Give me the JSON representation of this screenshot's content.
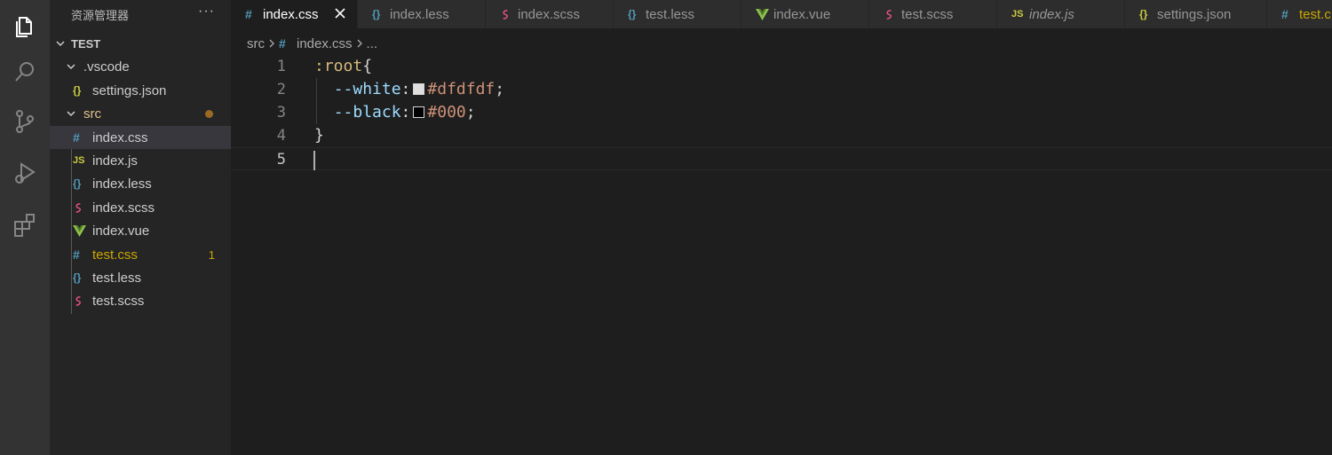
{
  "sidebar": {
    "title": "资源管理器",
    "more": "···",
    "tree": [
      {
        "label": "TEST",
        "kind": "root"
      },
      {
        "label": ".vscode",
        "kind": "folder"
      },
      {
        "label": "settings.json",
        "kind": "file",
        "icon": "{}"
      },
      {
        "label": "src",
        "kind": "folder"
      },
      {
        "label": "index.css",
        "kind": "file",
        "icon": "#"
      },
      {
        "label": "index.js",
        "kind": "file",
        "icon": "JS"
      },
      {
        "label": "index.less",
        "kind": "file",
        "icon": "{}"
      },
      {
        "label": "index.scss",
        "kind": "file",
        "icon": "sass"
      },
      {
        "label": "index.vue",
        "kind": "file",
        "icon": "vue"
      },
      {
        "label": "test.css",
        "kind": "file",
        "icon": "#",
        "badge": "1"
      },
      {
        "label": "test.less",
        "kind": "file",
        "icon": "{}"
      },
      {
        "label": "test.scss",
        "kind": "file",
        "icon": "sass"
      }
    ]
  },
  "tabs": [
    {
      "label": "index.css",
      "icon": "#"
    },
    {
      "label": "index.less",
      "icon": "{}"
    },
    {
      "label": "index.scss",
      "icon": "sass"
    },
    {
      "label": "test.less",
      "icon": "{}"
    },
    {
      "label": "index.vue",
      "icon": "vue"
    },
    {
      "label": "test.scss",
      "icon": "sass"
    },
    {
      "label": "index.js",
      "icon": "JS"
    },
    {
      "label": "settings.json",
      "icon": "{}"
    },
    {
      "label": "test.c",
      "icon": "#"
    }
  ],
  "breadcrumb": {
    "folder": "src",
    "file": "index.css",
    "rest": "..."
  },
  "editor": {
    "line_numbers": [
      "1",
      "2",
      "3",
      "4",
      "5"
    ],
    "line1": {
      "selector": ":root",
      "brace": "{"
    },
    "line2": {
      "prop": "--white",
      "colon": ":",
      "value": "#dfdfdf",
      "semi": ";",
      "swatch": "#dfdfdf"
    },
    "line3": {
      "prop": "--black",
      "colon": ":",
      "value": "#000",
      "semi": ";",
      "swatch": "#000000"
    },
    "line4": {
      "brace": "}"
    }
  }
}
